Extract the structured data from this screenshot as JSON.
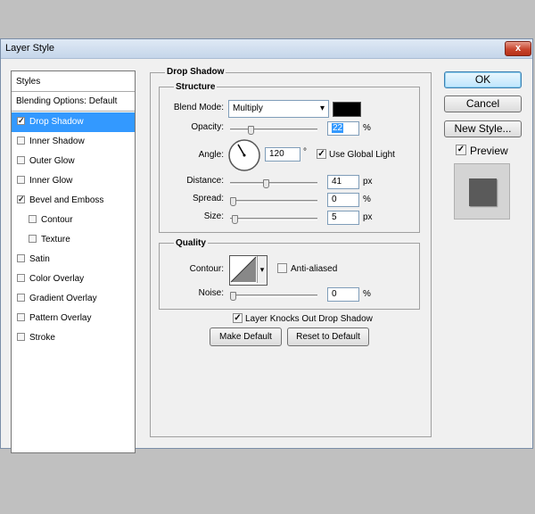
{
  "window": {
    "title": "Layer Style",
    "close_glyph": "x"
  },
  "styles_panel": {
    "header": "Styles",
    "blending_options": "Blending Options: Default",
    "items": [
      {
        "label": "Drop Shadow",
        "checked": true,
        "selected": true,
        "indent": false
      },
      {
        "label": "Inner Shadow",
        "checked": false,
        "selected": false,
        "indent": false
      },
      {
        "label": "Outer Glow",
        "checked": false,
        "selected": false,
        "indent": false
      },
      {
        "label": "Inner Glow",
        "checked": false,
        "selected": false,
        "indent": false
      },
      {
        "label": "Bevel and Emboss",
        "checked": true,
        "selected": false,
        "indent": false
      },
      {
        "label": "Contour",
        "checked": false,
        "selected": false,
        "indent": true
      },
      {
        "label": "Texture",
        "checked": false,
        "selected": false,
        "indent": true
      },
      {
        "label": "Satin",
        "checked": false,
        "selected": false,
        "indent": false
      },
      {
        "label": "Color Overlay",
        "checked": false,
        "selected": false,
        "indent": false
      },
      {
        "label": "Gradient Overlay",
        "checked": false,
        "selected": false,
        "indent": false
      },
      {
        "label": "Pattern Overlay",
        "checked": false,
        "selected": false,
        "indent": false
      },
      {
        "label": "Stroke",
        "checked": false,
        "selected": false,
        "indent": false
      }
    ]
  },
  "drop_shadow": {
    "title": "Drop Shadow",
    "structure": {
      "title": "Structure",
      "blend_mode_label": "Blend Mode:",
      "blend_mode_value": "Multiply",
      "shadow_color": "#000000",
      "opacity_label": "Opacity:",
      "opacity_value": "22",
      "opacity_fraction": 0.22,
      "percent": "%",
      "angle_label": "Angle:",
      "angle_value": "120",
      "angle_deg": 120,
      "degree": "°",
      "global_light_label": "Use Global Light",
      "global_light_checked": true,
      "distance_label": "Distance:",
      "distance_value": "41",
      "distance_fraction": 0.41,
      "spread_label": "Spread:",
      "spread_value": "0",
      "spread_fraction": 0,
      "size_label": "Size:",
      "size_value": "5",
      "size_fraction": 0.02,
      "px": "px"
    },
    "quality": {
      "title": "Quality",
      "contour_label": "Contour:",
      "anti_aliased_label": "Anti-aliased",
      "anti_aliased_checked": false,
      "noise_label": "Noise:",
      "noise_value": "0",
      "noise_fraction": 0,
      "percent": "%"
    },
    "knockout_label": "Layer Knocks Out Drop Shadow",
    "knockout_checked": true,
    "make_default": "Make Default",
    "reset_default": "Reset to Default"
  },
  "buttons": {
    "ok": "OK",
    "cancel": "Cancel",
    "new_style": "New Style...",
    "preview_label": "Preview",
    "preview_checked": true
  },
  "check_glyph": "✓",
  "dropdown_glyph": "▾"
}
